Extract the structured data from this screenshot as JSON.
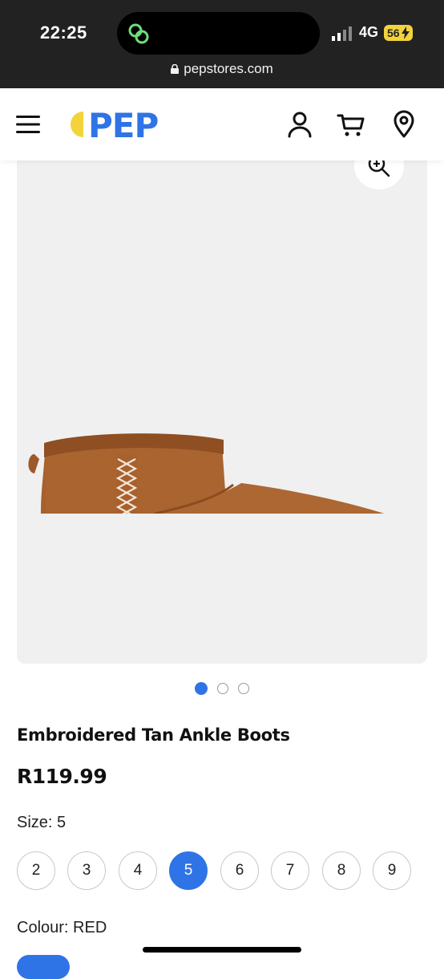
{
  "status_bar": {
    "time": "22:25",
    "network": "4G",
    "battery": "56"
  },
  "browser": {
    "url": "pepstores.com"
  },
  "header": {
    "logo_text": "PEP",
    "brand_color": "#2f74e6",
    "accent_color": "#f2d33b",
    "icons": [
      "menu-icon",
      "account-icon",
      "cart-icon",
      "location-icon"
    ]
  },
  "gallery": {
    "zoom_icon": "zoom-in-icon",
    "image_count": 3,
    "active_index": 0
  },
  "product": {
    "title": "Embroidered Tan Ankle Boots",
    "price": "R119.99",
    "size_label": "Size: 5",
    "sizes": [
      "2",
      "3",
      "4",
      "5",
      "6",
      "7",
      "8",
      "9"
    ],
    "selected_size": "5",
    "colour_label": "Colour: RED"
  }
}
